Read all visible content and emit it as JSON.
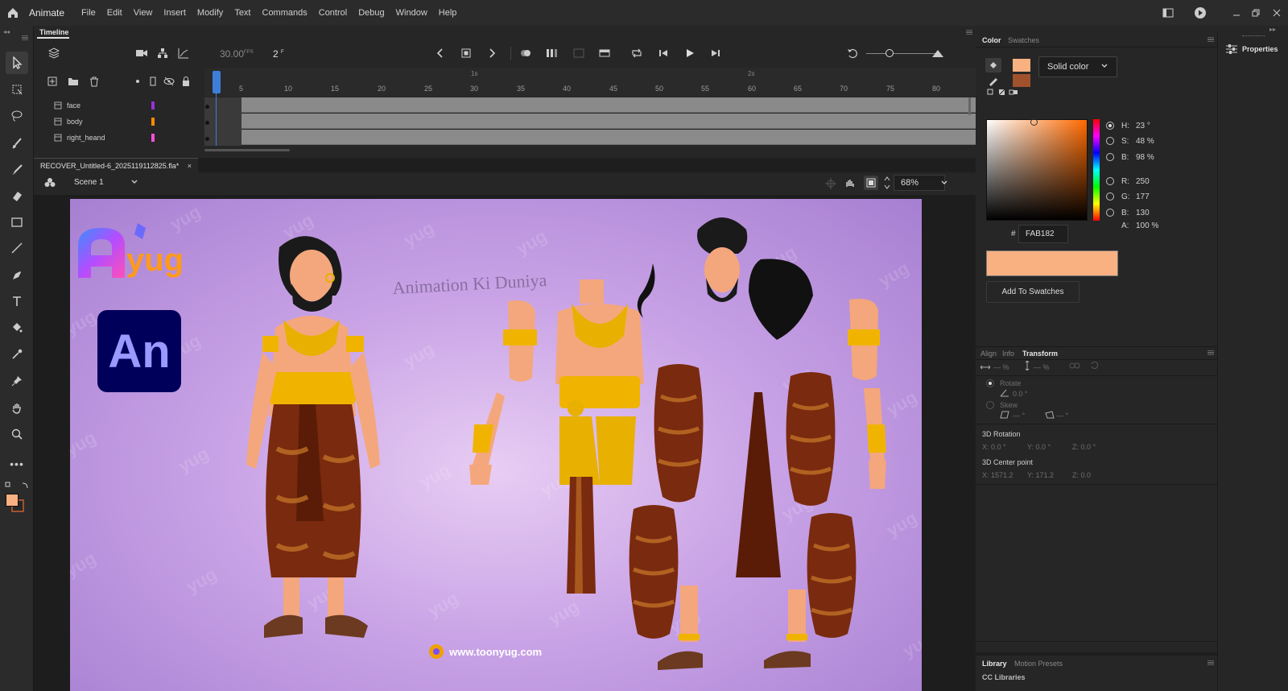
{
  "app": {
    "name": "Animate"
  },
  "menu": [
    "File",
    "Edit",
    "View",
    "Insert",
    "Modify",
    "Text",
    "Commands",
    "Control",
    "Debug",
    "Window",
    "Help"
  ],
  "timeline": {
    "tab": "Timeline",
    "fps": "30.00",
    "fps_unit": "FPS",
    "frame": "2",
    "frame_unit": "F",
    "ruler": [
      "5",
      "10",
      "15",
      "20",
      "25",
      "30",
      "35",
      "40",
      "45",
      "50",
      "55",
      "60",
      "65",
      "70",
      "75",
      "80"
    ],
    "seconds": [
      "1s",
      "2s"
    ],
    "layers": [
      {
        "name": "face",
        "color": "#9b30d9"
      },
      {
        "name": "body",
        "color": "#ff8c00"
      },
      {
        "name": "right_heand",
        "color": "#ff4fd8"
      }
    ]
  },
  "document": {
    "tab": "RECOVER_Untitled-6_2025119112825.fla*",
    "scene": "Scene 1",
    "zoom": "68%"
  },
  "stage": {
    "logo_text": "yug",
    "an_badge": "An",
    "title": "Animation Ki Duniya",
    "url": "www.toonyug.com",
    "watermark": "yug"
  },
  "color_panel": {
    "tabs": [
      "Color",
      "Swatches"
    ],
    "fill_type": "Solid color",
    "stroke_color": "#a0522d",
    "fill_color": "#FAB182",
    "H": {
      "label": "H:",
      "value": "23 °"
    },
    "S": {
      "label": "S:",
      "value": "48 %"
    },
    "B": {
      "label": "B:",
      "value": "98 %"
    },
    "R": {
      "label": "R:",
      "value": "250"
    },
    "G": {
      "label": "G:",
      "value": "177"
    },
    "Bl": {
      "label": "B:",
      "value": "130"
    },
    "A": {
      "label": "A:",
      "value": "100 %"
    },
    "hash": "#",
    "hex": "FAB182",
    "add_swatch": "Add To Swatches"
  },
  "transform_panel": {
    "tabs": [
      "Align",
      "Info",
      "Transform"
    ],
    "w": "— %",
    "h": "— %",
    "rotate": "Rotate",
    "rotate_val": "0.0 °",
    "skew": "Skew",
    "skew_x": "— °",
    "skew_y": "— °",
    "rot3d": "3D Rotation",
    "rot3d_x": "X:  0.0 °",
    "rot3d_y": "Y:  0.0 °",
    "rot3d_z": "Z:  0.0 °",
    "center3d": "3D Center point",
    "cx": "X:  1571.2",
    "cy": "Y:  171.2",
    "cz": "Z:  0.0"
  },
  "library_panel": {
    "tabs": [
      "Library",
      "Motion Presets"
    ],
    "sub": "CC Libraries"
  },
  "properties": {
    "label": "Properties"
  }
}
